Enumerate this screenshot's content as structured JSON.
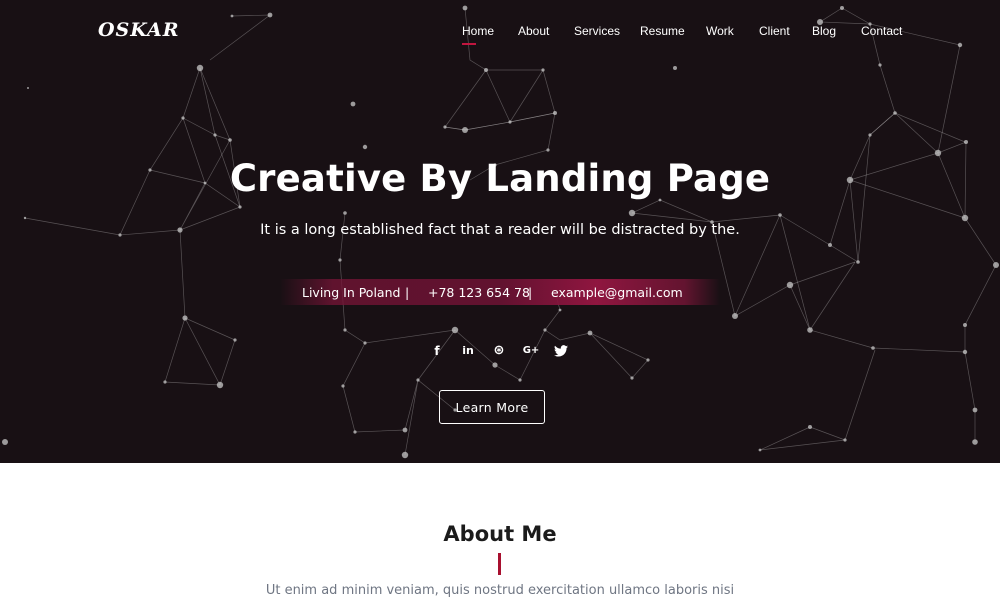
{
  "brand": {
    "logo": "OSKAR"
  },
  "nav": {
    "items": [
      {
        "label": "Home",
        "active": true
      },
      {
        "label": "About"
      },
      {
        "label": "Services"
      },
      {
        "label": "Resume"
      },
      {
        "label": "Work"
      },
      {
        "label": "Client"
      },
      {
        "label": "Blog"
      },
      {
        "label": "Contact"
      }
    ]
  },
  "hero": {
    "title": "Creative By Landing Page",
    "subtitle": "It is a long established fact that a reader will be distracted by the.",
    "info": {
      "location": "Living In Poland",
      "phone": "+78 123 654 78",
      "email": "example@gmail.com",
      "separator": "|"
    },
    "social": [
      {
        "icon": "facebook-icon",
        "glyph": "f"
      },
      {
        "icon": "linkedin-icon",
        "glyph": "in"
      },
      {
        "icon": "dribbble-icon",
        "glyph": "⊛"
      },
      {
        "icon": "google-plus-icon",
        "glyph": "G+"
      },
      {
        "icon": "twitter-icon",
        "glyph": "🐦"
      }
    ],
    "cta_label": "Learn More"
  },
  "about": {
    "title_bold": "About",
    "title_rest": " Me",
    "text": "Ut enim ad minim veniam, quis nostrud exercitation ullamco laboris nisi"
  },
  "colors": {
    "hero_bg": "#181014",
    "accent": "#c1163f",
    "about_text": "#6f7683"
  }
}
